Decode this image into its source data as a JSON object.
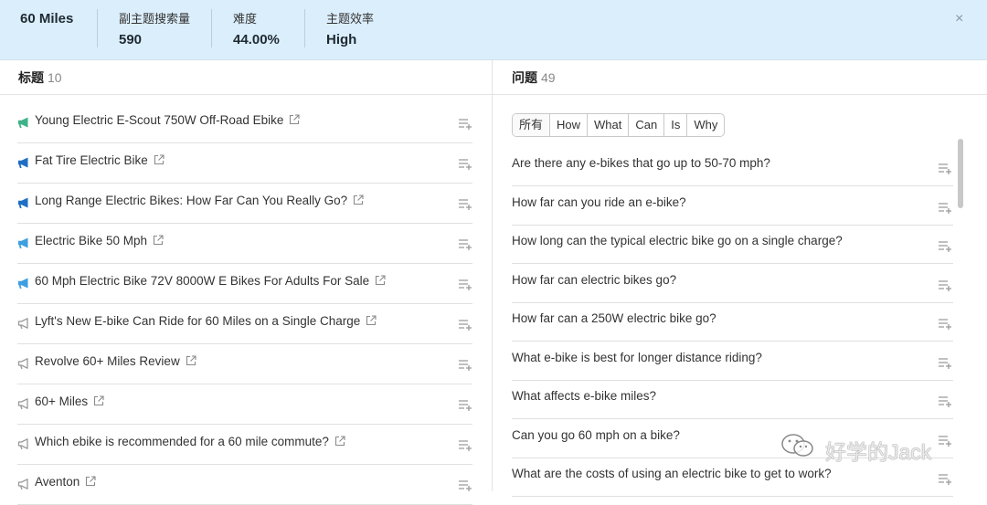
{
  "header": {
    "title": "60 Miles",
    "stats": [
      {
        "label": "副主题搜索量",
        "value": "590"
      },
      {
        "label": "难度",
        "value": "44.00%"
      },
      {
        "label": "主题效率",
        "value": "High"
      }
    ],
    "close_icon": "×"
  },
  "titles_panel": {
    "heading": "标题",
    "count": "10",
    "items": [
      {
        "text": "Young Electric E-Scout 750W Off-Road Ebike",
        "icon_color": "#3fb28a"
      },
      {
        "text": "Fat Tire Electric Bike",
        "icon_color": "#1e6fc4"
      },
      {
        "text": "Long Range Electric Bikes: How Far Can You Really Go?",
        "icon_color": "#1e6fc4"
      },
      {
        "text": "Electric Bike 50 Mph",
        "icon_color": "#3e9fe0"
      },
      {
        "text": "60 Mph Electric Bike 72V 8000W E Bikes For Adults For Sale",
        "icon_color": "#3e9fe0"
      },
      {
        "text": "Lyft's New E-bike Can Ride for 60 Miles on a Single Charge",
        "icon_color": "#999999"
      },
      {
        "text": "Revolve 60+ Miles Review",
        "icon_color": "#999999"
      },
      {
        "text": "60+ Miles",
        "icon_color": "#999999"
      },
      {
        "text": "Which ebike is recommended for a 60 mile commute?",
        "icon_color": "#999999"
      },
      {
        "text": "Aventon",
        "icon_color": "#999999"
      }
    ]
  },
  "questions_panel": {
    "heading": "问题",
    "count": "49",
    "filters": [
      "所有",
      "How",
      "What",
      "Can",
      "Is",
      "Why"
    ],
    "items": [
      "Are there any e-bikes that go up to 50-70 mph?",
      "How far can you ride an e-bike?",
      "How long can the typical electric bike go on a single charge?",
      "How far can electric bikes go?",
      "How far can a 250W electric bike go?",
      "What e-bike is best for longer distance riding?",
      "What affects e-bike miles?",
      "Can you go 60 mph on a bike?",
      "What are the costs of using an electric bike to get to work?"
    ]
  },
  "watermark": {
    "text": "好学的Jack"
  },
  "colors": {
    "header_bg": "#dbeefb",
    "divider": "#e0e0e0",
    "icon_gray": "#9a9a9a"
  },
  "icons": {
    "speaker": "megaphone-icon",
    "external": "external-link-icon",
    "add": "add-to-list-icon",
    "close": "close-icon"
  }
}
